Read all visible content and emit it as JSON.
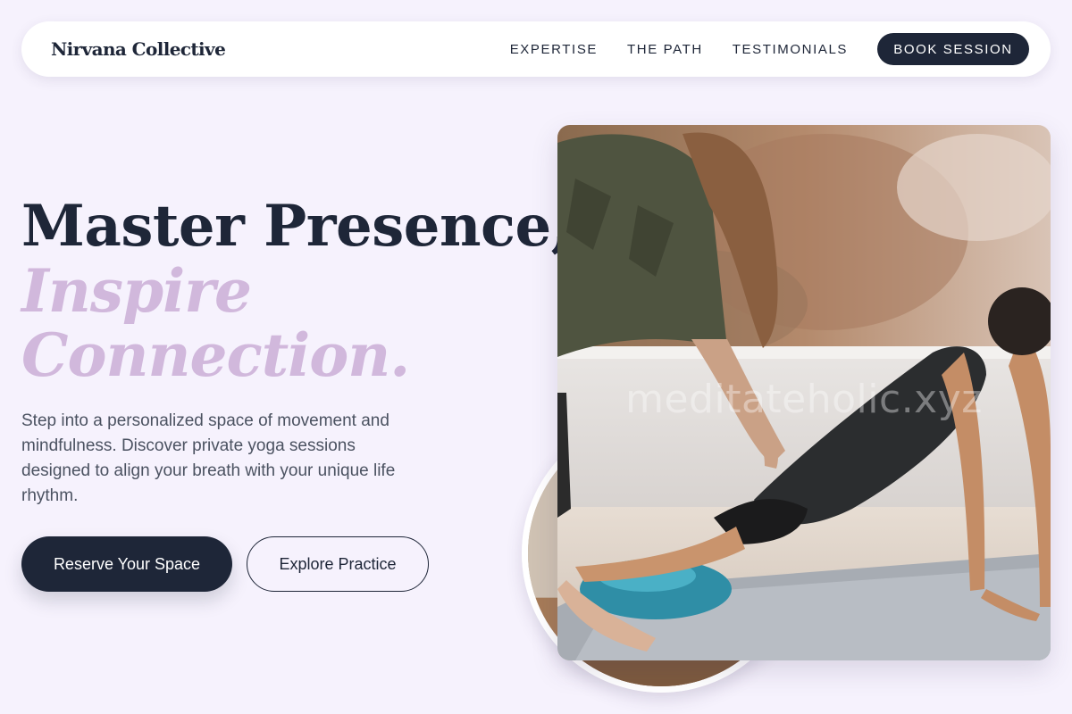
{
  "nav": {
    "brand": "Nirvana Collective",
    "links": [
      "EXPERTISE",
      "THE PATH",
      "TESTIMONIALS"
    ],
    "cta": "BOOK SESSION"
  },
  "hero": {
    "title_line1": "Master Presence,",
    "title_line2": "Inspire",
    "title_line3": "Connection.",
    "description": "Step into a personalized space of movement and mindfulness. Discover private yoga sessions designed to align your breath with your unique life rhythm.",
    "primary_button": "Reserve Your Space",
    "secondary_button": "Explore Practice"
  },
  "image": {
    "watermark": "meditateholic.xyz"
  },
  "colors": {
    "background": "#f6f2fd",
    "navy": "#1e2638",
    "accent_lilac": "#d1b8dc",
    "body_text": "#4b5261"
  }
}
